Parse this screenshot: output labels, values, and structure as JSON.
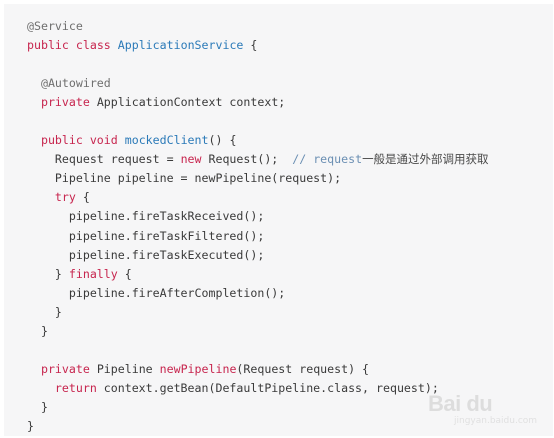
{
  "code": {
    "lines": [
      [
        {
          "t": "@Service",
          "c": "anno"
        }
      ],
      [
        {
          "t": "public ",
          "c": "kw"
        },
        {
          "t": "class ",
          "c": "kw"
        },
        {
          "t": "ApplicationService",
          "c": "type"
        },
        {
          "t": " {",
          "c": ""
        }
      ],
      [],
      [
        {
          "t": "  @Autowired",
          "c": "anno"
        }
      ],
      [
        {
          "t": "  private ",
          "c": "kw"
        },
        {
          "t": "ApplicationContext context;",
          "c": ""
        }
      ],
      [],
      [
        {
          "t": "  public ",
          "c": "kw"
        },
        {
          "t": "void ",
          "c": "kw"
        },
        {
          "t": "mockedClient",
          "c": "fn"
        },
        {
          "t": "() {",
          "c": ""
        }
      ],
      [
        {
          "t": "    Request request = ",
          "c": ""
        },
        {
          "t": "new ",
          "c": "kw"
        },
        {
          "t": "Request();  ",
          "c": ""
        },
        {
          "t": "// request",
          "c": "cm"
        },
        {
          "t": "一般是通过外部调用获取",
          "c": "cm-cjk"
        }
      ],
      [
        {
          "t": "    Pipeline pipeline = newPipeline(request);",
          "c": ""
        }
      ],
      [
        {
          "t": "    try ",
          "c": "kw"
        },
        {
          "t": "{",
          "c": ""
        }
      ],
      [
        {
          "t": "      pipeline.fireTaskReceived();",
          "c": ""
        }
      ],
      [
        {
          "t": "      pipeline.fireTaskFiltered();",
          "c": ""
        }
      ],
      [
        {
          "t": "      pipeline.fireTaskExecuted();",
          "c": ""
        }
      ],
      [
        {
          "t": "    } ",
          "c": ""
        },
        {
          "t": "finally ",
          "c": "kw"
        },
        {
          "t": "{",
          "c": ""
        }
      ],
      [
        {
          "t": "      pipeline.fireAfterCompletion();",
          "c": ""
        }
      ],
      [
        {
          "t": "    }",
          "c": ""
        }
      ],
      [
        {
          "t": "  }",
          "c": ""
        }
      ],
      [],
      [
        {
          "t": "  private ",
          "c": "kw"
        },
        {
          "t": "Pipeline ",
          "c": ""
        },
        {
          "t": "newPipeline",
          "c": "kw"
        },
        {
          "t": "(Request request) {",
          "c": ""
        }
      ],
      [
        {
          "t": "    return ",
          "c": "kw"
        },
        {
          "t": "context.getBean(DefaultPipeline.class, request);",
          "c": ""
        }
      ],
      [
        {
          "t": "  }",
          "c": ""
        }
      ],
      [
        {
          "t": "}",
          "c": ""
        }
      ]
    ]
  },
  "watermark": {
    "logo_text": "Bai du",
    "sub_text": "jingyan.baidu.com"
  }
}
